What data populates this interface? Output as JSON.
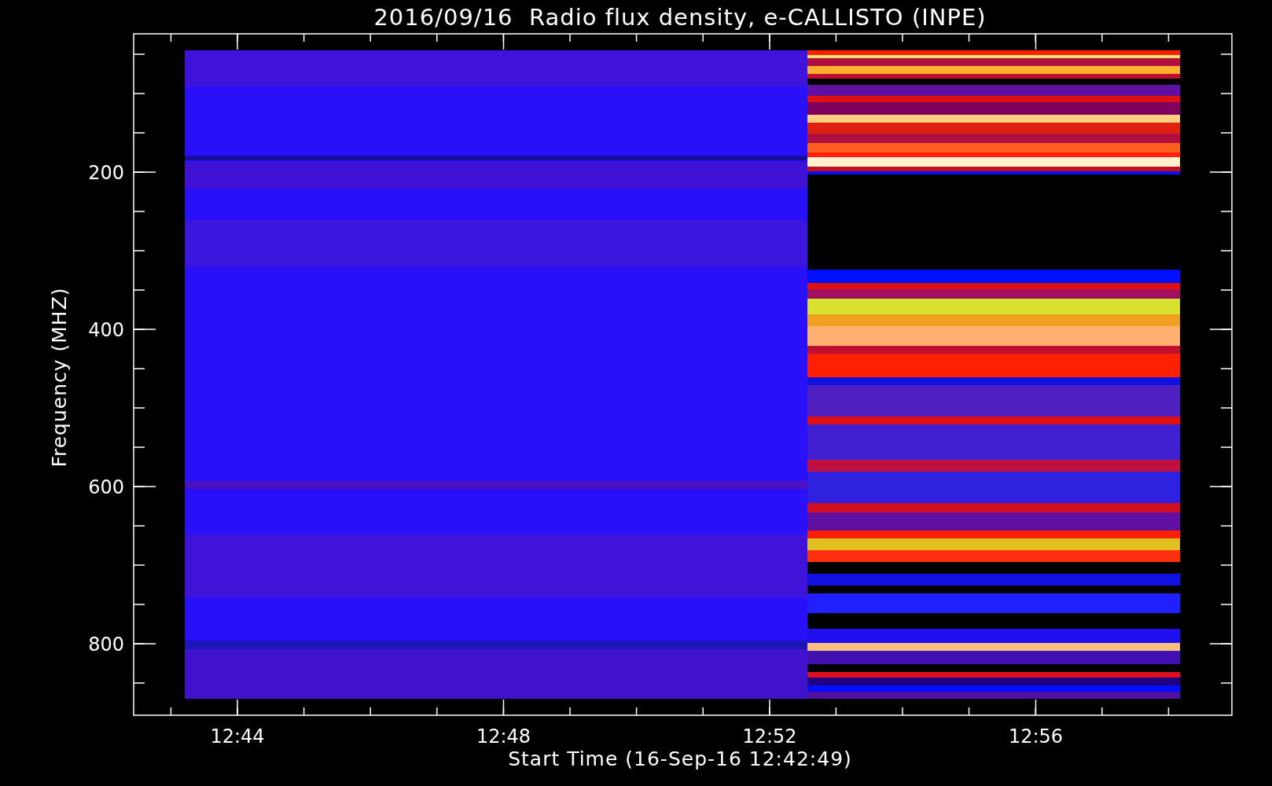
{
  "title": "2016/09/16  Radio flux density, e-CALLISTO (INPE)",
  "x_axis": {
    "label": "Start Time (16-Sep-16 12:42:49)",
    "ticks": [
      "12:44",
      "12:48",
      "12:52",
      "12:56"
    ]
  },
  "y_axis": {
    "label": "Frequency (MHZ)",
    "ticks": [
      "200",
      "400",
      "600",
      "800"
    ]
  }
}
